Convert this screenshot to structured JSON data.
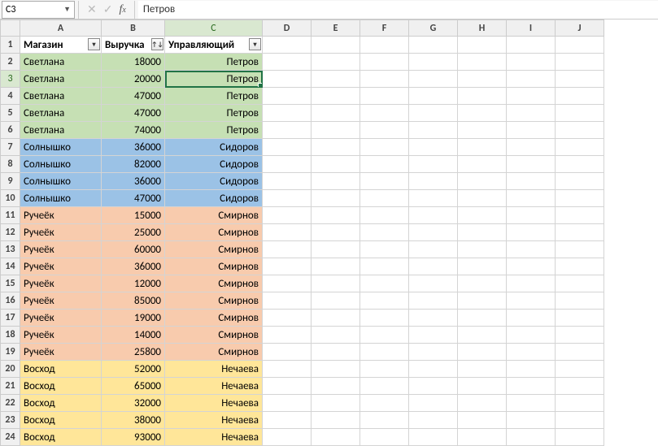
{
  "formula_bar": {
    "name_box": "C3",
    "formula": "Петров"
  },
  "columns": [
    "A",
    "B",
    "C",
    "D",
    "E",
    "F",
    "G",
    "H",
    "I",
    "J"
  ],
  "col_widths": {
    "rowhdr": 24,
    "A": 100,
    "B": 78,
    "C": 120,
    "other": 60
  },
  "headers": {
    "A": "Магазин",
    "B": "Выручка",
    "C": "Управляющий",
    "filters": {
      "A": "▾",
      "B": "↑↓",
      "C": "▾"
    }
  },
  "active_cell": "C3",
  "rows": [
    {
      "n": 2,
      "fill": "green",
      "A": "Светлана",
      "B": 18000,
      "C": "Петров"
    },
    {
      "n": 3,
      "fill": "green",
      "A": "Светлана",
      "B": 20000,
      "C": "Петров"
    },
    {
      "n": 4,
      "fill": "green",
      "A": "Светлана",
      "B": 47000,
      "C": "Петров"
    },
    {
      "n": 5,
      "fill": "green",
      "A": "Светлана",
      "B": 47000,
      "C": "Петров"
    },
    {
      "n": 6,
      "fill": "green",
      "A": "Светлана",
      "B": 74000,
      "C": "Петров"
    },
    {
      "n": 7,
      "fill": "blue",
      "A": "Солнышко",
      "B": 36000,
      "C": "Сидоров"
    },
    {
      "n": 8,
      "fill": "blue",
      "A": "Солнышко",
      "B": 82000,
      "C": "Сидоров"
    },
    {
      "n": 9,
      "fill": "blue",
      "A": "Солнышко",
      "B": 36000,
      "C": "Сидоров"
    },
    {
      "n": 10,
      "fill": "blue",
      "A": "Солнышко",
      "B": 47000,
      "C": "Сидоров"
    },
    {
      "n": 11,
      "fill": "orange",
      "A": "Ручеёк",
      "B": 15000,
      "C": "Смирнов"
    },
    {
      "n": 12,
      "fill": "orange",
      "A": "Ручеёк",
      "B": 25000,
      "C": "Смирнов"
    },
    {
      "n": 13,
      "fill": "orange",
      "A": "Ручеёк",
      "B": 60000,
      "C": "Смирнов"
    },
    {
      "n": 14,
      "fill": "orange",
      "A": "Ручеёк",
      "B": 36000,
      "C": "Смирнов"
    },
    {
      "n": 15,
      "fill": "orange",
      "A": "Ручеёк",
      "B": 12000,
      "C": "Смирнов"
    },
    {
      "n": 16,
      "fill": "orange",
      "A": "Ручеёк",
      "B": 85000,
      "C": "Смирнов"
    },
    {
      "n": 17,
      "fill": "orange",
      "A": "Ручеёк",
      "B": 19000,
      "C": "Смирнов"
    },
    {
      "n": 18,
      "fill": "orange",
      "A": "Ручеёк",
      "B": 14000,
      "C": "Смирнов"
    },
    {
      "n": 19,
      "fill": "orange",
      "A": "Ручеёк",
      "B": 25800,
      "C": "Смирнов"
    },
    {
      "n": 20,
      "fill": "yellow",
      "A": "Восход",
      "B": 52000,
      "C": "Нечаева"
    },
    {
      "n": 21,
      "fill": "yellow",
      "A": "Восход",
      "B": 65000,
      "C": "Нечаева"
    },
    {
      "n": 22,
      "fill": "yellow",
      "A": "Восход",
      "B": 32000,
      "C": "Нечаева"
    },
    {
      "n": 23,
      "fill": "yellow",
      "A": "Восход",
      "B": 38000,
      "C": "Нечаева"
    },
    {
      "n": 24,
      "fill": "yellow",
      "A": "Восход",
      "B": 93000,
      "C": "Нечаева"
    }
  ]
}
